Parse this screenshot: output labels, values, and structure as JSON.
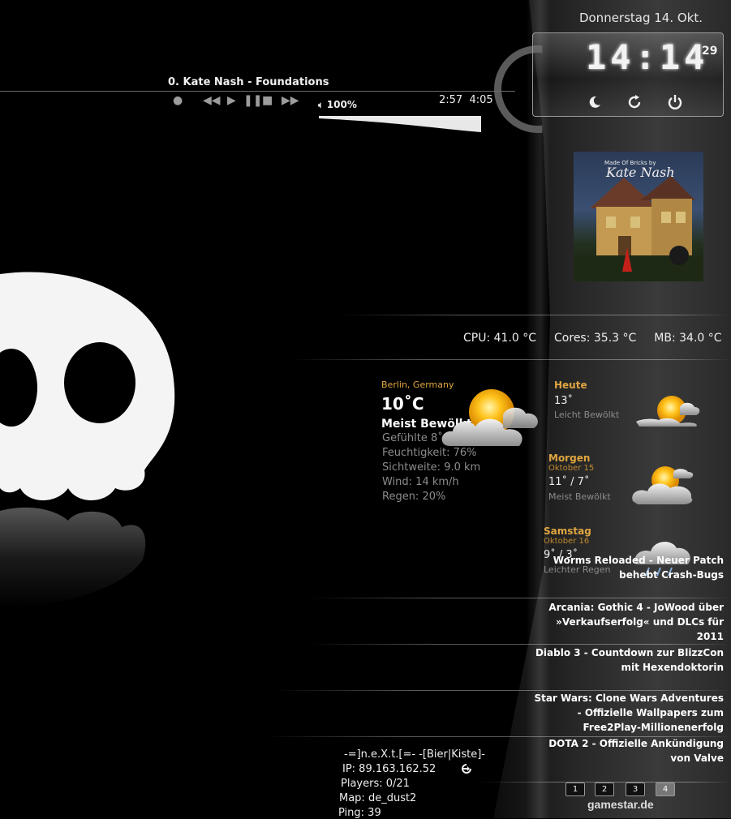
{
  "clock": {
    "date": "Donnerstag 14. Okt.",
    "time": "14:14",
    "seconds": "29",
    "controls": [
      "sleep-icon",
      "refresh-icon",
      "power-icon"
    ]
  },
  "player": {
    "track": "0. Kate Nash - Foundations",
    "volume": "100%",
    "elapsed": "2:57",
    "total": "4:05",
    "volume_level": 1.0
  },
  "album": {
    "artist": "Kate Nash",
    "subtitle": "Made Of Bricks by"
  },
  "temps": {
    "cpu": "CPU: 41.0 °C",
    "cores": "Cores:  35.3 °C",
    "mb": "MB: 34.0 °C"
  },
  "weather": {
    "location": "Berlin, Germany",
    "temp": "10˚C",
    "condition": "Meist Bewölkt",
    "details": [
      "Gefühlte 8˚",
      "Feuchtigkeit: 76%",
      "Sichtweite: 9.0 km",
      "Wind: 14 km/h",
      "Regen: 20%"
    ],
    "forecast": [
      {
        "day": "Heute",
        "date": "",
        "temp": "13˚",
        "cond": "Leicht Bewölkt"
      },
      {
        "day": "Morgen",
        "date": "Oktober 15",
        "temp": "11˚ / 7˚",
        "cond": "Meist Bewölkt"
      },
      {
        "day": "Samstag",
        "date": "Oktober 16",
        "temp": "9˚ / 3˚",
        "cond": "Leichter Regen"
      }
    ]
  },
  "news": {
    "items": [
      "Worms Reloaded - Neuer Patch behebt Crash-Bugs",
      "Arcania: Gothic 4 - JoWood über »Verkaufserfolg« und DLCs für 2011",
      "Diablo 3 - Countdown zur BlizzCon mit Hexendoktorin",
      "Star Wars: Clone Wars Adventures - Offizielle Wallpapers zum Free2Play-Millionenerfolg",
      "DOTA 2 - Offizielle Ankündigung von Valve"
    ],
    "pages": [
      "1",
      "2",
      "3",
      "4"
    ],
    "active_page": "4",
    "source": "gamestar.de"
  },
  "server": {
    "name": "-=]n.e.X.t.[=- -[Bier|Kiste]-",
    "ip": "IP: 89.163.162.52",
    "players": "Players: 0/21",
    "map": "Map: de_dust2",
    "ping": "Ping: 39"
  }
}
